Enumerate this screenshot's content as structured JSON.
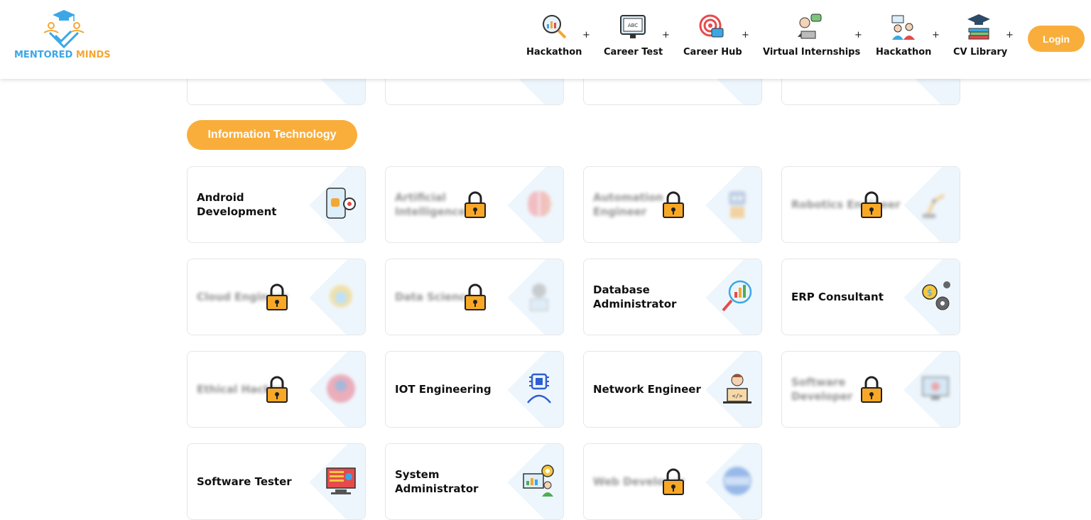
{
  "brand": {
    "name_part1": "MENTORED ",
    "name_part2": "MINDS"
  },
  "nav": [
    {
      "label": "Hackathon",
      "icon": "magnifier-chart-icon"
    },
    {
      "label": "Career Test",
      "icon": "abc-board-icon"
    },
    {
      "label": "Career Hub",
      "icon": "target-briefcase-icon"
    },
    {
      "label": "Virtual Internships",
      "icon": "person-laptop-chat-icon"
    },
    {
      "label": "Hackathon",
      "icon": "team-presentation-icon"
    },
    {
      "label": "CV Library",
      "icon": "graduation-books-icon"
    }
  ],
  "nav_plus": "+",
  "login_label": "Login",
  "section": {
    "title": "Information Technology"
  },
  "cards": [
    {
      "title": "Android Development",
      "locked": false,
      "icon": "android-phone-gear-icon"
    },
    {
      "title": "Artificial Intelligence",
      "locked": true,
      "icon": "brain-circuit-icon"
    },
    {
      "title": "Automation Engineer",
      "locked": true,
      "icon": "robot-icon"
    },
    {
      "title": "Robotics Engineer",
      "locked": true,
      "icon": "robot-arm-icon"
    },
    {
      "title": "Cloud Engineer",
      "locked": true,
      "icon": "cloud-gear-icon"
    },
    {
      "title": "Data Science",
      "locked": true,
      "icon": "scientist-icon"
    },
    {
      "title": "Database Administrator",
      "locked": false,
      "icon": "magnifier-bar-chart-icon"
    },
    {
      "title": "ERP Consultant",
      "locked": false,
      "icon": "gears-dollar-icon"
    },
    {
      "title": "Ethical Hacker",
      "locked": true,
      "icon": "hacker-avatar-icon"
    },
    {
      "title": "IOT Engineering",
      "locked": false,
      "icon": "chip-person-icon"
    },
    {
      "title": "Network Engineer",
      "locked": false,
      "icon": "developer-laptop-icon"
    },
    {
      "title": "Software Developer",
      "locked": true,
      "icon": "monitor-code-icon"
    },
    {
      "title": "Software Tester",
      "locked": false,
      "icon": "monitor-test-icon"
    },
    {
      "title": "System Administrator",
      "locked": false,
      "icon": "admin-dashboard-gear-icon"
    },
    {
      "title": "Web Developer",
      "locked": true,
      "icon": "www-globe-icon"
    }
  ],
  "colors": {
    "accent": "#f9ae3b",
    "brand_blue": "#3ba7e6",
    "card_diamond": "#eef6fd",
    "lock": "#f9a826"
  }
}
